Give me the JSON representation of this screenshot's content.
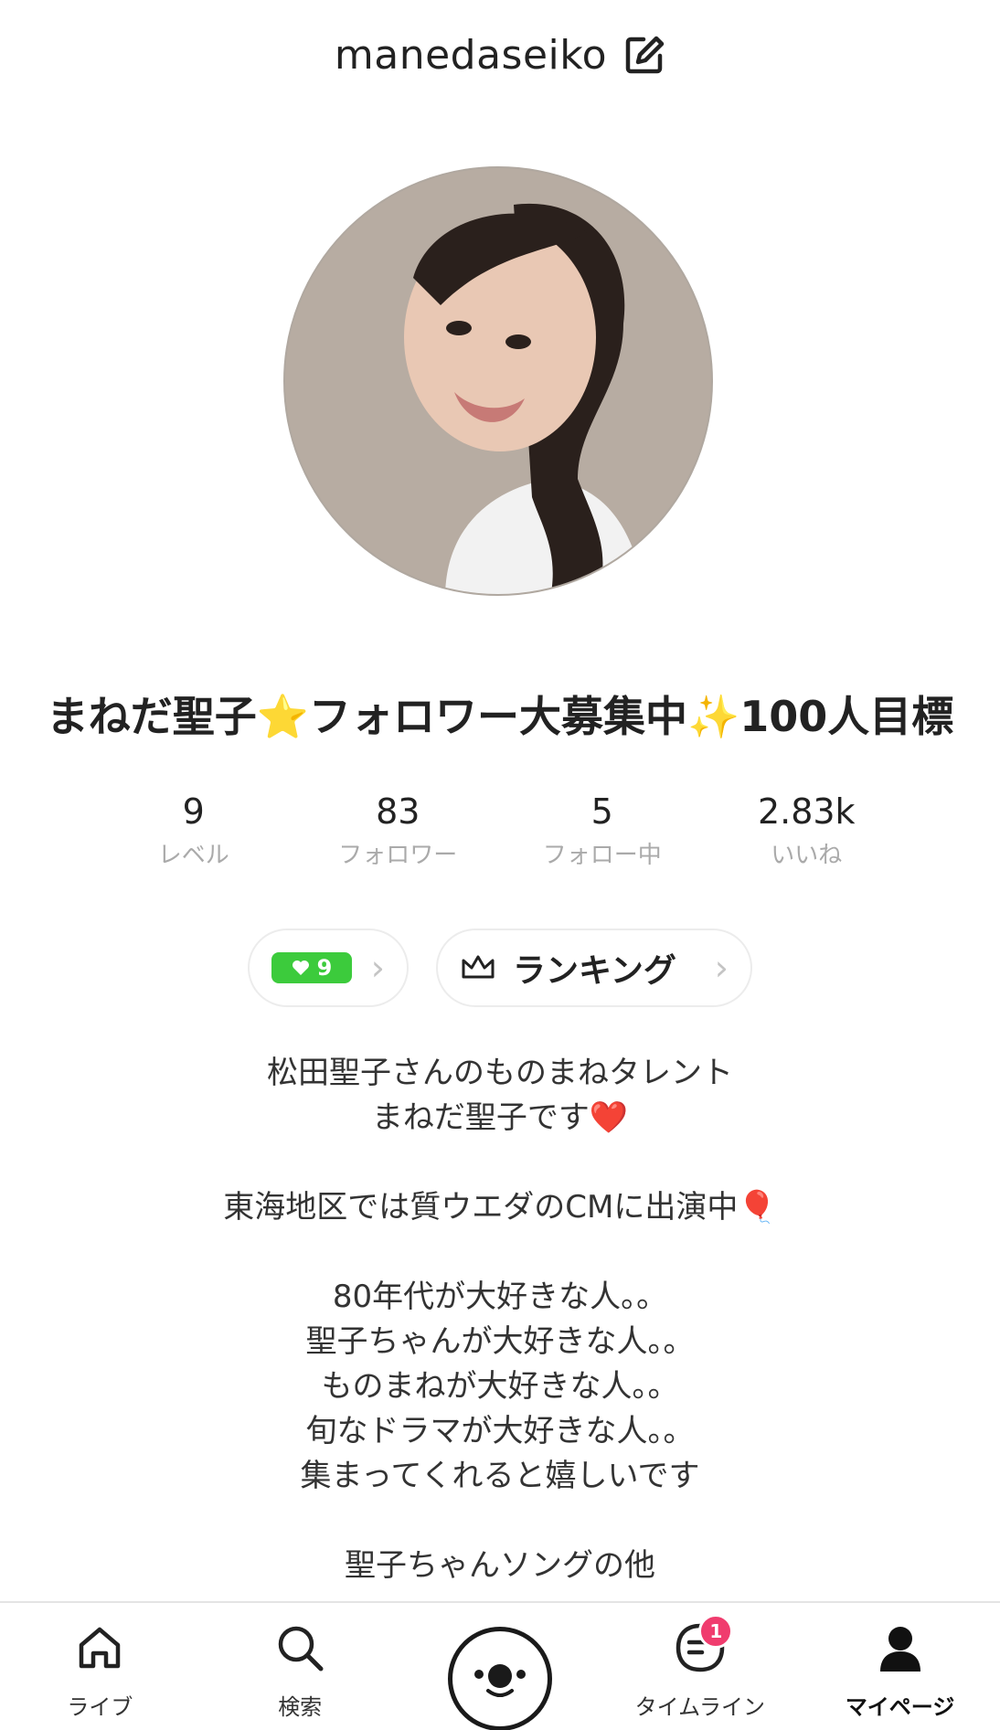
{
  "header": {
    "username": "manedaseiko"
  },
  "profile": {
    "display_name": "まねだ聖子⭐フォロワー大募集中✨100人目標",
    "stats": [
      {
        "value": "9",
        "label": "レベル"
      },
      {
        "value": "83",
        "label": "フォロワー"
      },
      {
        "value": "5",
        "label": "フォロー中"
      },
      {
        "value": "2.83k",
        "label": "いいね"
      }
    ],
    "like_count": "9",
    "ranking_label": "ランキング",
    "bio_lines": [
      "松田聖子さんのものまねタレント",
      "まねだ聖子です❤️",
      "",
      "東海地区では質ウエダのCMに出演中🎈",
      "",
      "80年代が大好きな人。。",
      "聖子ちゃんが大好きな人。。",
      "ものまねが大好きな人。。",
      "旬なドラマが大好きな人。。",
      "集まってくれると嬉しいです",
      "",
      "聖子ちゃんソングの他"
    ]
  },
  "nav": {
    "items": [
      {
        "label": "ライブ",
        "icon": "home-icon"
      },
      {
        "label": "検索",
        "icon": "search-icon"
      },
      {
        "label": "",
        "icon": "camera-face-icon"
      },
      {
        "label": "タイムライン",
        "icon": "timeline-icon",
        "badge": "1"
      },
      {
        "label": "マイページ",
        "icon": "person-icon"
      }
    ]
  },
  "colors": {
    "accent_green": "#3ccb3c",
    "badge_pink": "#f03c6e"
  }
}
